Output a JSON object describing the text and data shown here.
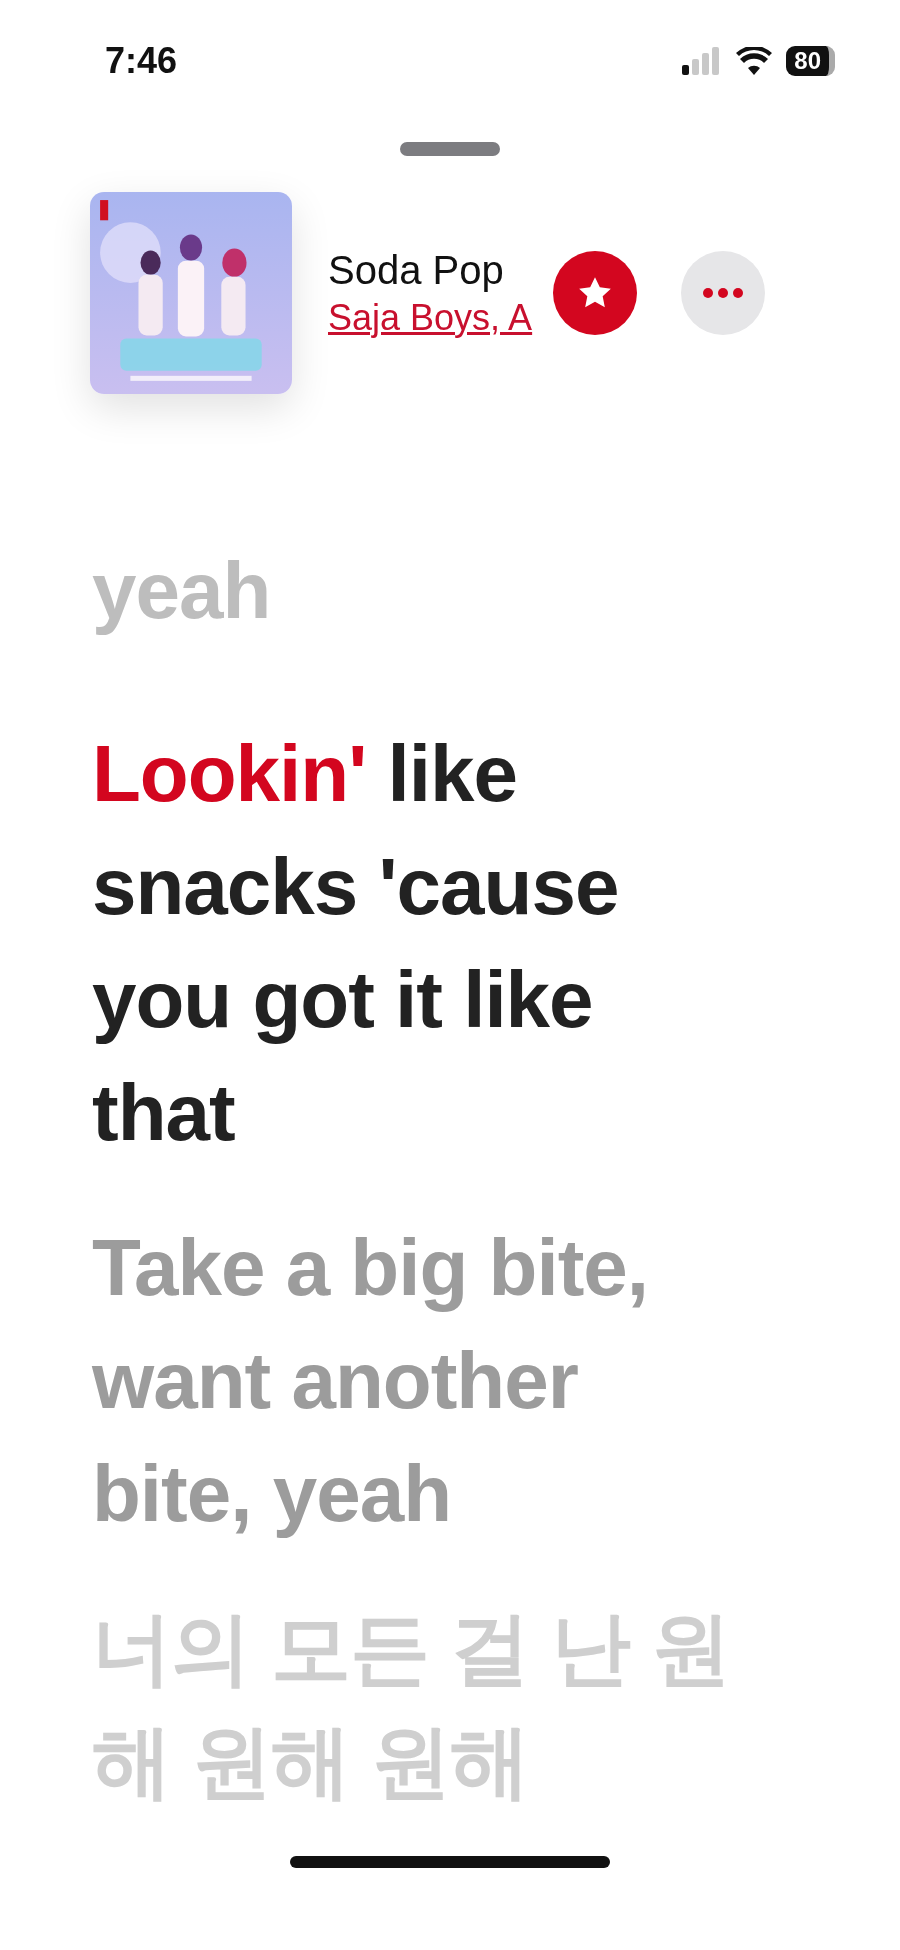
{
  "status_bar": {
    "time": "7:46",
    "battery": "80"
  },
  "now_playing": {
    "title": "Soda Pop",
    "artist": "Saja Boys, A",
    "favorite": true
  },
  "lyrics": [
    {
      "kind": "past",
      "text": "yeah"
    },
    {
      "kind": "current",
      "sung": "Lookin'",
      "text": " like snacks 'cause you got it like that"
    },
    {
      "kind": "upcoming",
      "text": "Take a big bite, want another bite, yeah"
    },
    {
      "kind": "later",
      "text": "너의 모든 걸 난 원해 원해 원해"
    }
  ]
}
